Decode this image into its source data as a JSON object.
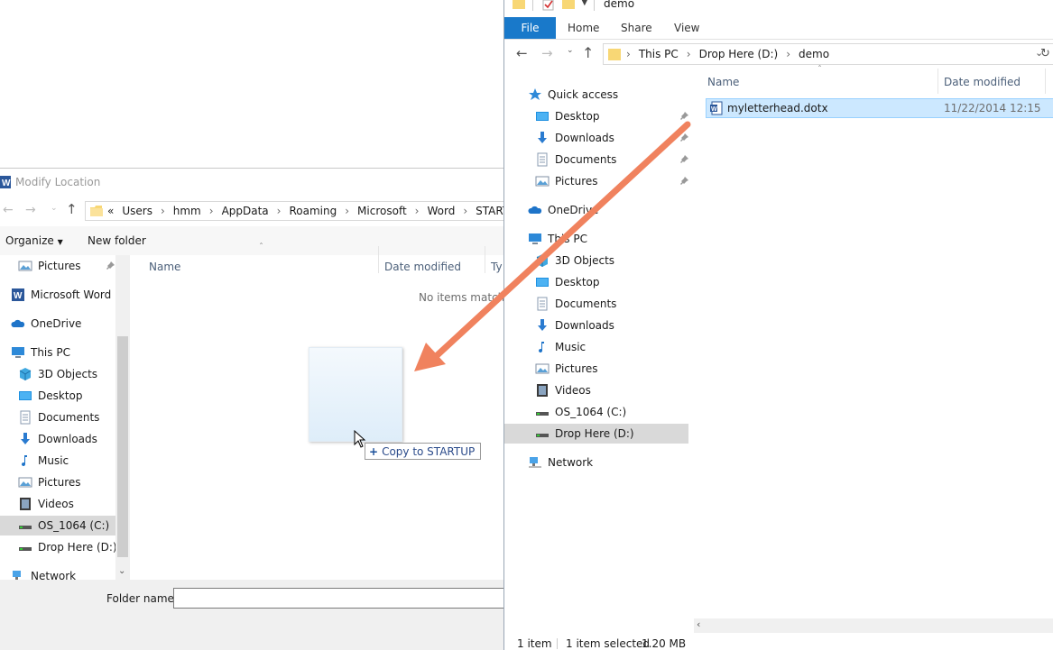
{
  "dialog": {
    "title": "Modify Location",
    "breadcrumb": [
      "«",
      "Users",
      "hmm",
      "AppData",
      "Roaming",
      "Microsoft",
      "Word",
      "STARTUP"
    ],
    "organize_label": "Organize",
    "new_folder_label": "New folder",
    "nav_items": [
      {
        "label": "Pictures",
        "icon": "pictures-icon"
      },
      {
        "label": "Microsoft Word",
        "icon": "word-icon"
      },
      {
        "label": "OneDrive",
        "icon": "onedrive-icon"
      },
      {
        "label": "This PC",
        "icon": "pc-icon"
      },
      {
        "label": "3D Objects",
        "icon": "3d-objects-icon"
      },
      {
        "label": "Desktop",
        "icon": "desktop-icon"
      },
      {
        "label": "Documents",
        "icon": "documents-icon"
      },
      {
        "label": "Downloads",
        "icon": "downloads-icon"
      },
      {
        "label": "Music",
        "icon": "music-icon"
      },
      {
        "label": "Pictures",
        "icon": "pictures-icon"
      },
      {
        "label": "Videos",
        "icon": "videos-icon"
      },
      {
        "label": "OS_1064 (C:)",
        "icon": "drive-icon"
      },
      {
        "label": "Drop Here (D:)",
        "icon": "drive-icon"
      },
      {
        "label": "Network",
        "icon": "network-icon"
      }
    ],
    "columns": {
      "name": "Name",
      "date": "Date modified",
      "type": "Ty"
    },
    "empty_message": "No items match",
    "folder_name_label": "Folder name:",
    "folder_name_value": ""
  },
  "drag": {
    "tooltip": "Copy to STARTUP",
    "prefix": "+"
  },
  "explorer": {
    "window_title": "demo",
    "ribbon_tabs": [
      "File",
      "Home",
      "Share",
      "View"
    ],
    "breadcrumb": [
      "This PC",
      "Drop Here (D:)",
      "demo"
    ],
    "nav_items": [
      {
        "label": "Quick access",
        "icon": "star-icon"
      },
      {
        "label": "Desktop",
        "icon": "desktop-icon"
      },
      {
        "label": "Downloads",
        "icon": "downloads-icon"
      },
      {
        "label": "Documents",
        "icon": "documents-icon"
      },
      {
        "label": "Pictures",
        "icon": "pictures-icon"
      },
      {
        "label": "OneDrive",
        "icon": "onedrive-icon"
      },
      {
        "label": "This PC",
        "icon": "pc-icon"
      },
      {
        "label": "3D Objects",
        "icon": "3d-objects-icon"
      },
      {
        "label": "Desktop",
        "icon": "desktop-icon"
      },
      {
        "label": "Documents",
        "icon": "documents-icon"
      },
      {
        "label": "Downloads",
        "icon": "downloads-icon"
      },
      {
        "label": "Music",
        "icon": "music-icon"
      },
      {
        "label": "Pictures",
        "icon": "pictures-icon"
      },
      {
        "label": "Videos",
        "icon": "videos-icon"
      },
      {
        "label": "OS_1064 (C:)",
        "icon": "drive-icon"
      },
      {
        "label": "Drop Here (D:)",
        "icon": "drive-icon"
      },
      {
        "label": "Network",
        "icon": "network-icon"
      }
    ],
    "columns": {
      "name": "Name",
      "date": "Date modified"
    },
    "files": [
      {
        "name": "myletterhead.dotx",
        "date": "11/22/2014 12:15",
        "icon": "word-doc-icon",
        "selected": true
      }
    ],
    "status": {
      "count": "1 item",
      "selection": "1 item selected",
      "size": "1.20 MB"
    }
  },
  "colors": {
    "accent": "#1979ca",
    "selection": "#cce8ff",
    "annotation_arrow": "#f0825e"
  }
}
